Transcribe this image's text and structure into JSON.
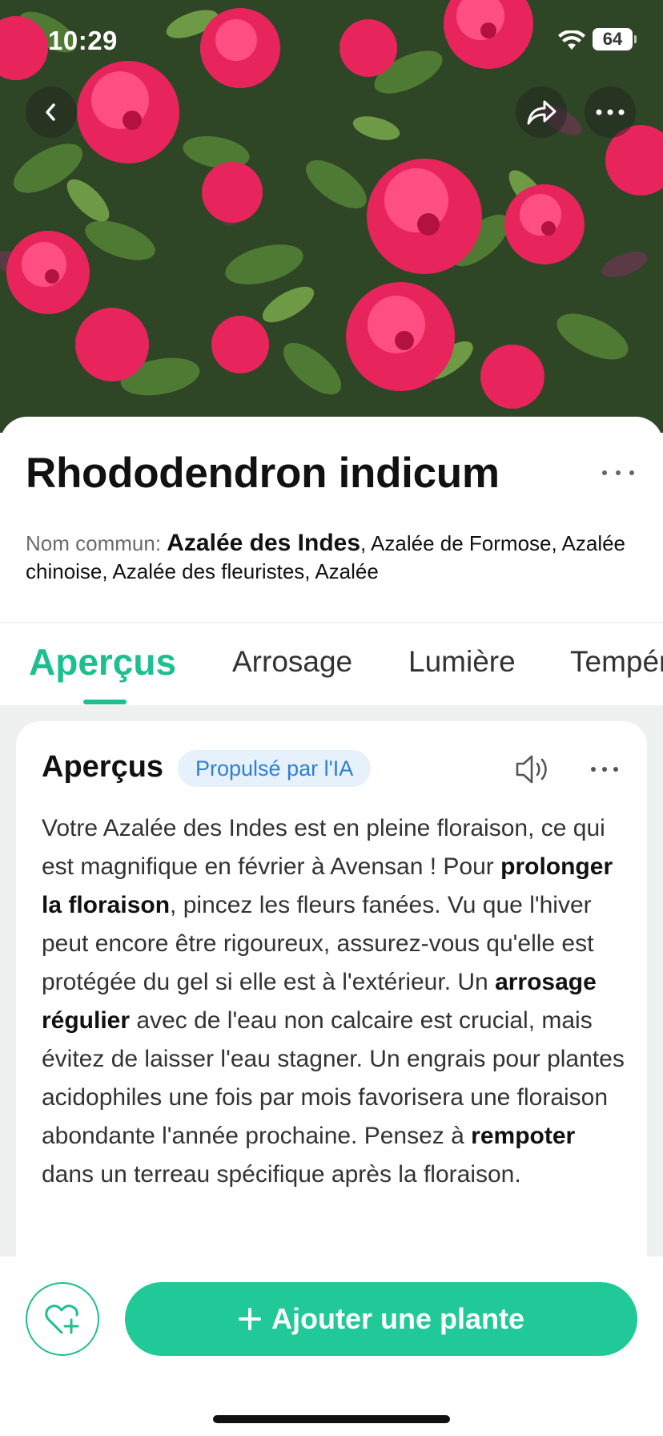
{
  "status_bar": {
    "time": "10:29",
    "battery": "64"
  },
  "hero": {
    "image_alt": "Pink azalea flowers"
  },
  "plant": {
    "title": "Rhododendron indicum",
    "common_label": "Nom commun: ",
    "common_primary": "Azalée des Indes",
    "common_others": ", Azalée de Formose, Azalée chinoise, Azalée des fleuristes, Azalée"
  },
  "tabs": [
    {
      "label": "Aperçus",
      "active": true
    },
    {
      "label": "Arrosage"
    },
    {
      "label": "Lumière"
    },
    {
      "label": "Température"
    }
  ],
  "overview": {
    "title": "Aperçus",
    "badge": "Propulsé par l'IA",
    "segments": [
      {
        "text": "Votre Azalée des Indes est en pleine floraison, ce qui est magnifique en février à Avensan ! Pour ",
        "bold": false
      },
      {
        "text": "prolonger la floraison",
        "bold": true
      },
      {
        "text": ", pincez les fleurs fanées. Vu que l'hiver peut encore être rigoureux, assurez-vous qu'elle est protégée du gel si elle est à l'extérieur. Un ",
        "bold": false
      },
      {
        "text": "arrosage régulier",
        "bold": true
      },
      {
        "text": " avec de l'eau non calcaire est crucial, mais évitez de laisser l'eau stagner. Un engrais pour plantes acidophiles une fois par mois favorisera une floraison abondante l'année prochaine. Pensez à ",
        "bold": false
      },
      {
        "text": "rempoter",
        "bold": true
      },
      {
        "text": " dans un terreau spécifique après la floraison.",
        "bold": false
      }
    ]
  },
  "actions": {
    "add_plant": "Ajouter une plante"
  },
  "colors": {
    "accent": "#20c997",
    "accent_text": "#1cbf8e",
    "badge_bg": "#e6f1fb",
    "badge_text": "#2e7fd6"
  }
}
